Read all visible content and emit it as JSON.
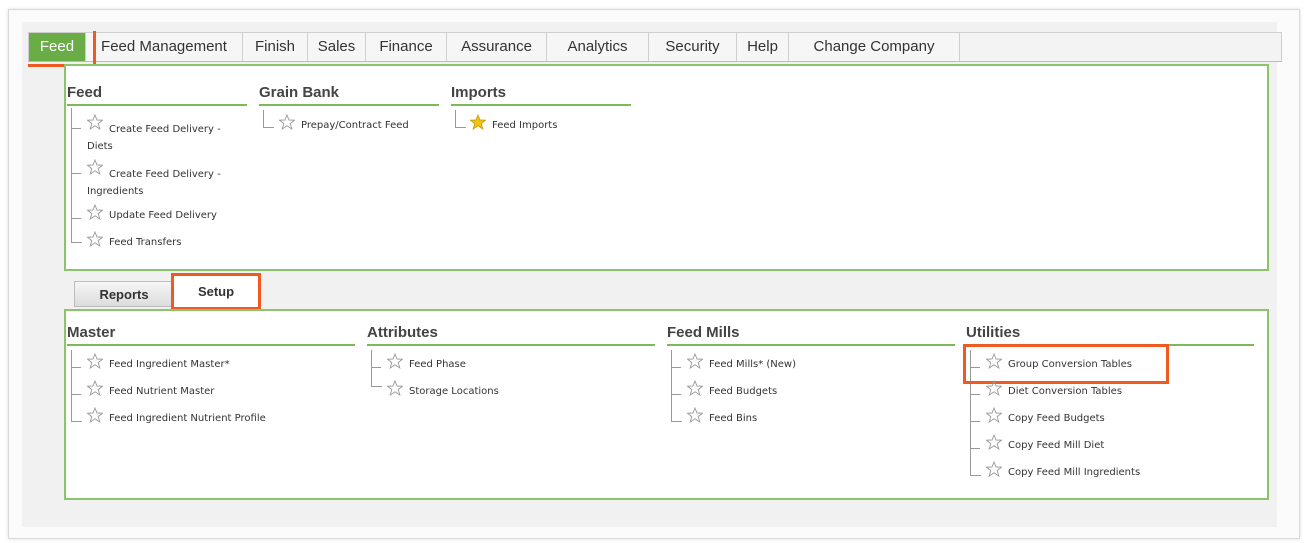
{
  "nav": {
    "tabs": [
      "Feed",
      "Feed Management",
      "Finish",
      "Sales",
      "Finance",
      "Assurance",
      "Analytics",
      "Security",
      "Help",
      "Change Company"
    ],
    "active_index": 0
  },
  "top_panel": {
    "columns": [
      {
        "heading": "Feed",
        "items": [
          {
            "label": "Create Feed Delivery - Diets",
            "favorite": false
          },
          {
            "label": "Create Feed Delivery - Ingredients",
            "favorite": false
          },
          {
            "label": "Update Feed Delivery",
            "favorite": false
          },
          {
            "label": "Feed Transfers",
            "favorite": false
          }
        ]
      },
      {
        "heading": "Grain Bank",
        "items": [
          {
            "label": "Prepay/Contract Feed",
            "favorite": false
          }
        ]
      },
      {
        "heading": "Imports",
        "items": [
          {
            "label": "Feed Imports",
            "favorite": true
          }
        ]
      }
    ]
  },
  "subtabs": {
    "reports_label": "Reports",
    "setup_label": "Setup",
    "active": "Setup"
  },
  "setup_panel": {
    "columns": [
      {
        "heading": "Master",
        "items": [
          {
            "label": "Feed Ingredient Master*",
            "favorite": false
          },
          {
            "label": "Feed Nutrient Master",
            "favorite": false
          },
          {
            "label": "Feed Ingredient Nutrient Profile",
            "favorite": false
          }
        ]
      },
      {
        "heading": "Attributes",
        "items": [
          {
            "label": "Feed Phase",
            "favorite": false
          },
          {
            "label": "Storage Locations",
            "favorite": false
          }
        ]
      },
      {
        "heading": "Feed Mills",
        "items": [
          {
            "label": "Feed Mills* (New)",
            "favorite": false
          },
          {
            "label": "Feed Budgets",
            "favorite": false
          },
          {
            "label": "Feed Bins",
            "favorite": false
          }
        ]
      },
      {
        "heading": "Utilities",
        "items": [
          {
            "label": "Group Conversion Tables",
            "favorite": false
          },
          {
            "label": "Diet Conversion Tables",
            "favorite": false
          },
          {
            "label": "Copy Feed Budgets",
            "favorite": false
          },
          {
            "label": "Copy Feed Mill Diet",
            "favorite": false
          },
          {
            "label": "Copy Feed Mill Ingredients",
            "favorite": false
          }
        ]
      }
    ]
  },
  "colors": {
    "accent_green": "#6aac45",
    "panel_border": "#8cc46a",
    "highlight_orange": "#ee5a22",
    "favorite_star": "#f0c419"
  }
}
